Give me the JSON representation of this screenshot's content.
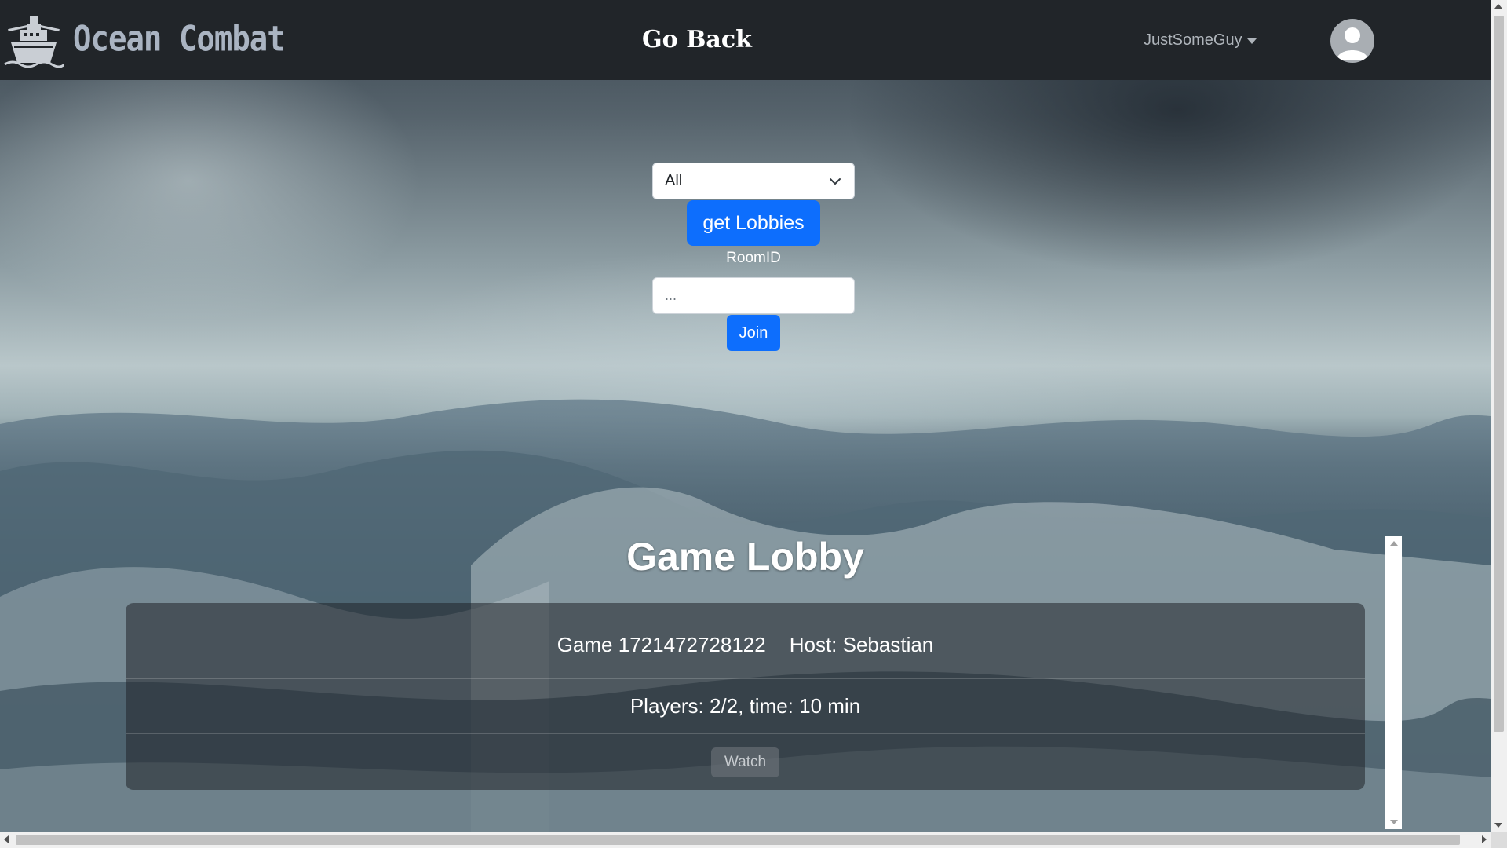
{
  "app": {
    "brand": "Ocean Combat",
    "logo_icon": "battleship-icon"
  },
  "navbar": {
    "go_back_label": "Go Back",
    "username": "JustSomeGuy",
    "avatar_icon": "user-avatar-icon"
  },
  "filter": {
    "selected": "All"
  },
  "buttons": {
    "get_lobbies": "get Lobbies",
    "join": "Join",
    "watch": "Watch"
  },
  "room": {
    "label": "RoomID",
    "placeholder": "..."
  },
  "lobby": {
    "title": "Game Lobby",
    "games": [
      {
        "game_label": "Game 1721472728122",
        "host_label": "Host: Sebastian",
        "details": "Players: 2/2, time: 10 min"
      }
    ]
  },
  "colors": {
    "navbar_bg": "#212529",
    "primary": "#0d6efd",
    "brand_text": "#aab4c2"
  }
}
